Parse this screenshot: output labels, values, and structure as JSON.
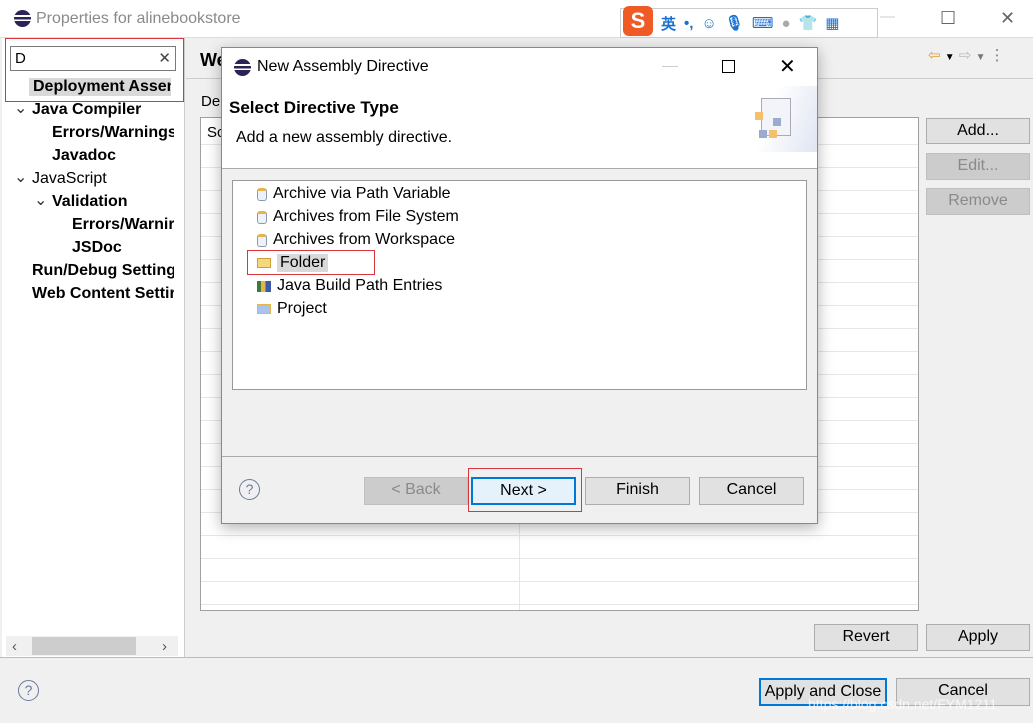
{
  "window": {
    "title": "Properties for alinebookstore",
    "minimize": "—",
    "maximize": "☐",
    "close": "✕"
  },
  "ime_toolbar": {
    "items": [
      "S",
      "英",
      "•,",
      "☺",
      "mic",
      "keyboard",
      "user",
      "shirt",
      "grid"
    ]
  },
  "filter": {
    "value": "D",
    "clear": "✕"
  },
  "tree": [
    {
      "label": "Deployment Assen",
      "bold": true,
      "selected": true
    },
    {
      "label": "Java Compiler",
      "bold": true,
      "chevron": "v"
    },
    {
      "label": "Errors/Warnings",
      "bold": true
    },
    {
      "label": "Javadoc",
      "bold": true
    },
    {
      "label": "JavaScript",
      "bold": false,
      "chevron": "v"
    },
    {
      "label": "Validation",
      "bold": true,
      "chevron": "v"
    },
    {
      "label": "Errors/Warnir",
      "bold": true
    },
    {
      "label": "JSDoc",
      "bold": true
    },
    {
      "label": "Run/Debug Setting",
      "bold": true
    },
    {
      "label": "Web Content Settir",
      "bold": true
    }
  ],
  "page": {
    "title": "We",
    "desc": "De",
    "col_header": "Sc"
  },
  "side_buttons": {
    "add": "Add...",
    "edit": "Edit...",
    "remove": "Remove"
  },
  "footer": {
    "revert": "Revert",
    "apply": "Apply",
    "apply_close": "Apply and Close",
    "cancel": "Cancel",
    "help": "?"
  },
  "dialog": {
    "title": "New Assembly Directive",
    "heading": "Select Directive Type",
    "description": "Add a new assembly directive.",
    "items": [
      {
        "label": "Archive via Path Variable",
        "icon": "jar-icon"
      },
      {
        "label": "Archives from File System",
        "icon": "jar-icon"
      },
      {
        "label": "Archives from Workspace",
        "icon": "jar-icon"
      },
      {
        "label": "Folder",
        "icon": "folder-icon",
        "selected": true
      },
      {
        "label": "Java Build Path Entries",
        "icon": "library-icon"
      },
      {
        "label": "Project",
        "icon": "project-folder-icon"
      }
    ],
    "buttons": {
      "back": "< Back",
      "next": "Next >",
      "finish": "Finish",
      "cancel": "Cancel"
    },
    "help": "?"
  },
  "watermark": "https://blog.csdn.net/FYM1211",
  "colors": {
    "highlight_box": "#d9363e",
    "default_button": "#0078d7",
    "selected": "#d9d9d9"
  }
}
